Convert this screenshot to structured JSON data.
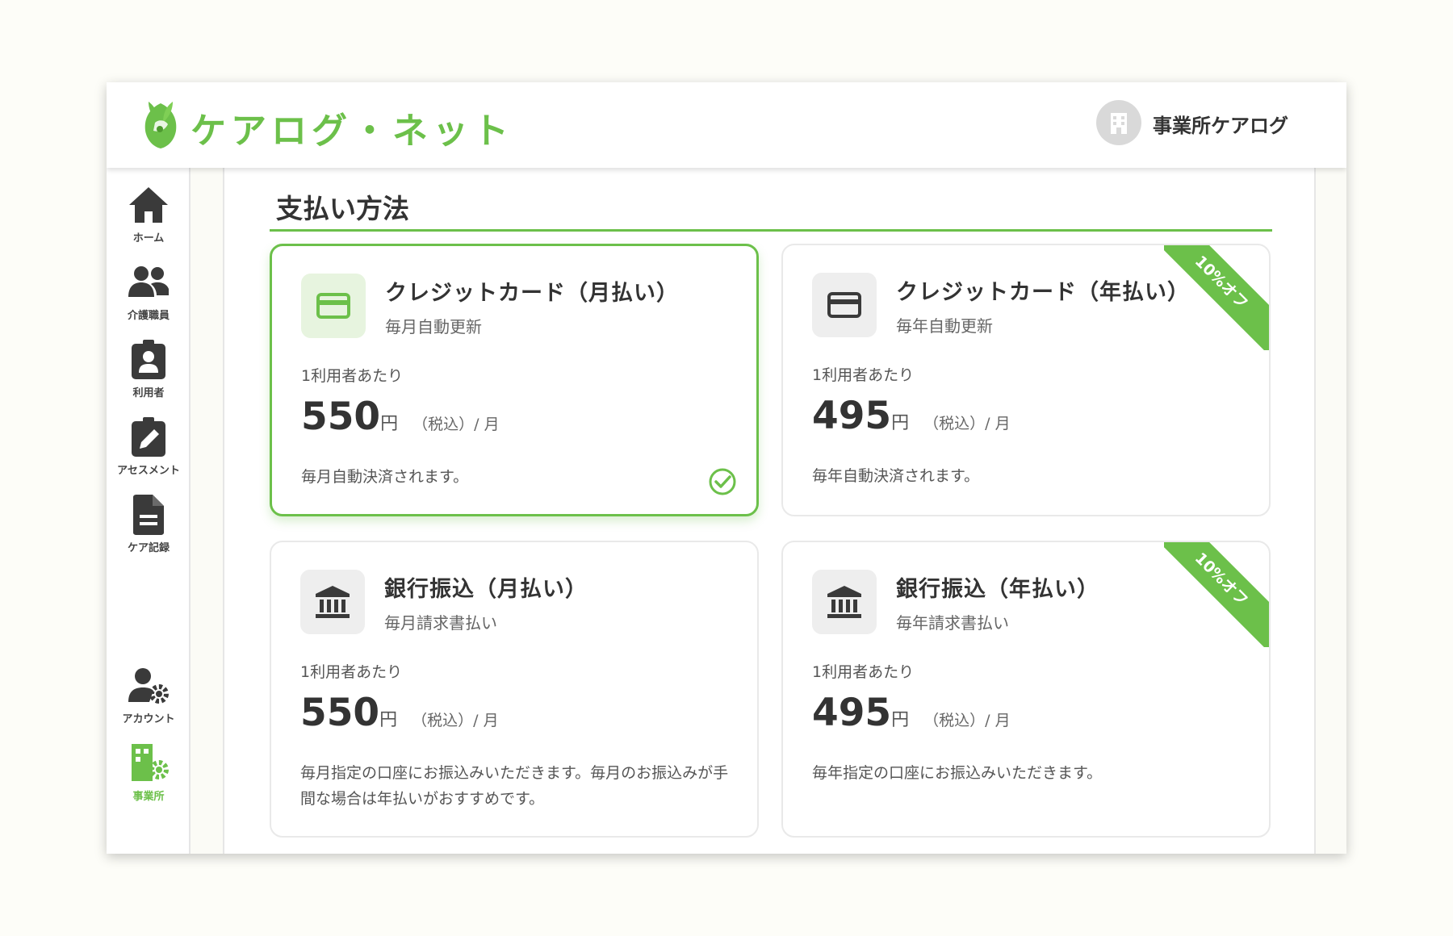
{
  "app": {
    "name": "ケアログ・ネット",
    "office_name": "事業所ケアログ"
  },
  "colors": {
    "brand": "#6cc04a",
    "text": "#333333",
    "icon_dark": "#3a3a3a"
  },
  "sidebar": {
    "items": [
      {
        "label": "ホーム",
        "icon": "home-icon",
        "active": false
      },
      {
        "label": "介護職員",
        "icon": "staff-icon",
        "active": false
      },
      {
        "label": "利用者",
        "icon": "user-badge-icon",
        "active": false
      },
      {
        "label": "アセスメント",
        "icon": "edit-icon",
        "active": false
      },
      {
        "label": "ケア記録",
        "icon": "document-icon",
        "active": false
      },
      {
        "label": "アカウント",
        "icon": "account-settings-icon",
        "active": false
      },
      {
        "label": "事業所",
        "icon": "office-settings-icon",
        "active": true
      }
    ]
  },
  "section": {
    "title": "支払い方法"
  },
  "payment_methods": [
    {
      "title": "クレジットカード（月払い）",
      "subtitle": "毎月自動更新",
      "per_user": "1利用者あたり",
      "price": "550",
      "yen": "円",
      "tax_period": "（税込）/ 月",
      "description": "毎月自動決済されます。",
      "icon": "credit-card-icon",
      "selected": true,
      "ribbon": ""
    },
    {
      "title": "クレジットカード（年払い）",
      "subtitle": "毎年自動更新",
      "per_user": "1利用者あたり",
      "price": "495",
      "yen": "円",
      "tax_period": "（税込）/ 月",
      "description": "毎年自動決済されます。",
      "icon": "credit-card-icon",
      "selected": false,
      "ribbon": "10%オフ"
    },
    {
      "title": "銀行振込（月払い）",
      "subtitle": "毎月請求書払い",
      "per_user": "1利用者あたり",
      "price": "550",
      "yen": "円",
      "tax_period": "（税込）/ 月",
      "description": "毎月指定の口座にお振込みいただきます。毎月のお振込みが手間な場合は年払いがおすすめです。",
      "icon": "bank-icon",
      "selected": false,
      "ribbon": ""
    },
    {
      "title": "銀行振込（年払い）",
      "subtitle": "毎年請求書払い",
      "per_user": "1利用者あたり",
      "price": "495",
      "yen": "円",
      "tax_period": "（税込）/ 月",
      "description": "毎年指定の口座にお振込みいただきます。",
      "icon": "bank-icon",
      "selected": false,
      "ribbon": "10%オフ"
    }
  ]
}
